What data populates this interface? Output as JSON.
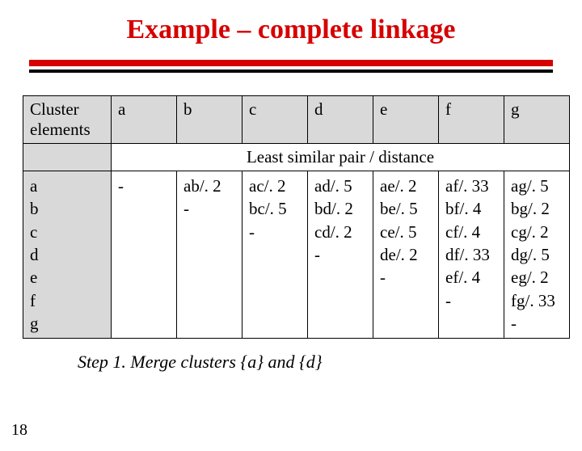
{
  "title": "Example – complete linkage",
  "header_label": "Cluster elements",
  "cols": [
    "a",
    "b",
    "c",
    "d",
    "e",
    "f",
    "g"
  ],
  "subheader": "Least similar pair / distance",
  "row_labels": "a\nb\nc\nd\ne\nf\ng",
  "cells": {
    "a": "-",
    "b": "ab/. 2\n-",
    "c": "ac/. 2\nbc/. 5\n-",
    "d": "ad/. 5\nbd/. 2\ncd/. 2\n-",
    "e": "ae/. 2\nbe/. 5\nce/. 5\nde/. 2\n-",
    "f": "af/. 33\nbf/. 4\ncf/. 4\ndf/. 33\nef/. 4\n-",
    "g": "ag/. 5\nbg/. 2\ncg/. 2\ndg/. 5\neg/. 2\nfg/. 33\n-"
  },
  "step": "Step 1.  Merge clusters {a} and {d}",
  "page_number": "18",
  "chart_data": {
    "type": "table",
    "title": "Example – complete linkage",
    "row_items": [
      "a",
      "b",
      "c",
      "d",
      "e",
      "f",
      "g"
    ],
    "col_items": [
      "a",
      "b",
      "c",
      "d",
      "e",
      "f",
      "g"
    ],
    "note": "Upper-triangular least-similar pair / distance matrix for complete-linkage clustering",
    "pairs": [
      {
        "i": "a",
        "j": "b",
        "pair": "ab",
        "distance": 0.2
      },
      {
        "i": "a",
        "j": "c",
        "pair": "ac",
        "distance": 0.2
      },
      {
        "i": "a",
        "j": "d",
        "pair": "ad",
        "distance": 0.5
      },
      {
        "i": "a",
        "j": "e",
        "pair": "ae",
        "distance": 0.2
      },
      {
        "i": "a",
        "j": "f",
        "pair": "af",
        "distance": 0.33
      },
      {
        "i": "a",
        "j": "g",
        "pair": "ag",
        "distance": 0.5
      },
      {
        "i": "b",
        "j": "c",
        "pair": "bc",
        "distance": 0.5
      },
      {
        "i": "b",
        "j": "d",
        "pair": "bd",
        "distance": 0.2
      },
      {
        "i": "b",
        "j": "e",
        "pair": "be",
        "distance": 0.5
      },
      {
        "i": "b",
        "j": "f",
        "pair": "bf",
        "distance": 0.4
      },
      {
        "i": "b",
        "j": "g",
        "pair": "bg",
        "distance": 0.2
      },
      {
        "i": "c",
        "j": "d",
        "pair": "cd",
        "distance": 0.2
      },
      {
        "i": "c",
        "j": "e",
        "pair": "ce",
        "distance": 0.5
      },
      {
        "i": "c",
        "j": "f",
        "pair": "cf",
        "distance": 0.4
      },
      {
        "i": "c",
        "j": "g",
        "pair": "cg",
        "distance": 0.2
      },
      {
        "i": "d",
        "j": "e",
        "pair": "de",
        "distance": 0.2
      },
      {
        "i": "d",
        "j": "f",
        "pair": "df",
        "distance": 0.33
      },
      {
        "i": "d",
        "j": "g",
        "pair": "dg",
        "distance": 0.5
      },
      {
        "i": "e",
        "j": "f",
        "pair": "ef",
        "distance": 0.4
      },
      {
        "i": "e",
        "j": "g",
        "pair": "eg",
        "distance": 0.2
      },
      {
        "i": "f",
        "j": "g",
        "pair": "fg",
        "distance": 0.33
      }
    ],
    "step": {
      "number": 1,
      "action": "Merge clusters {a} and {d}"
    }
  }
}
